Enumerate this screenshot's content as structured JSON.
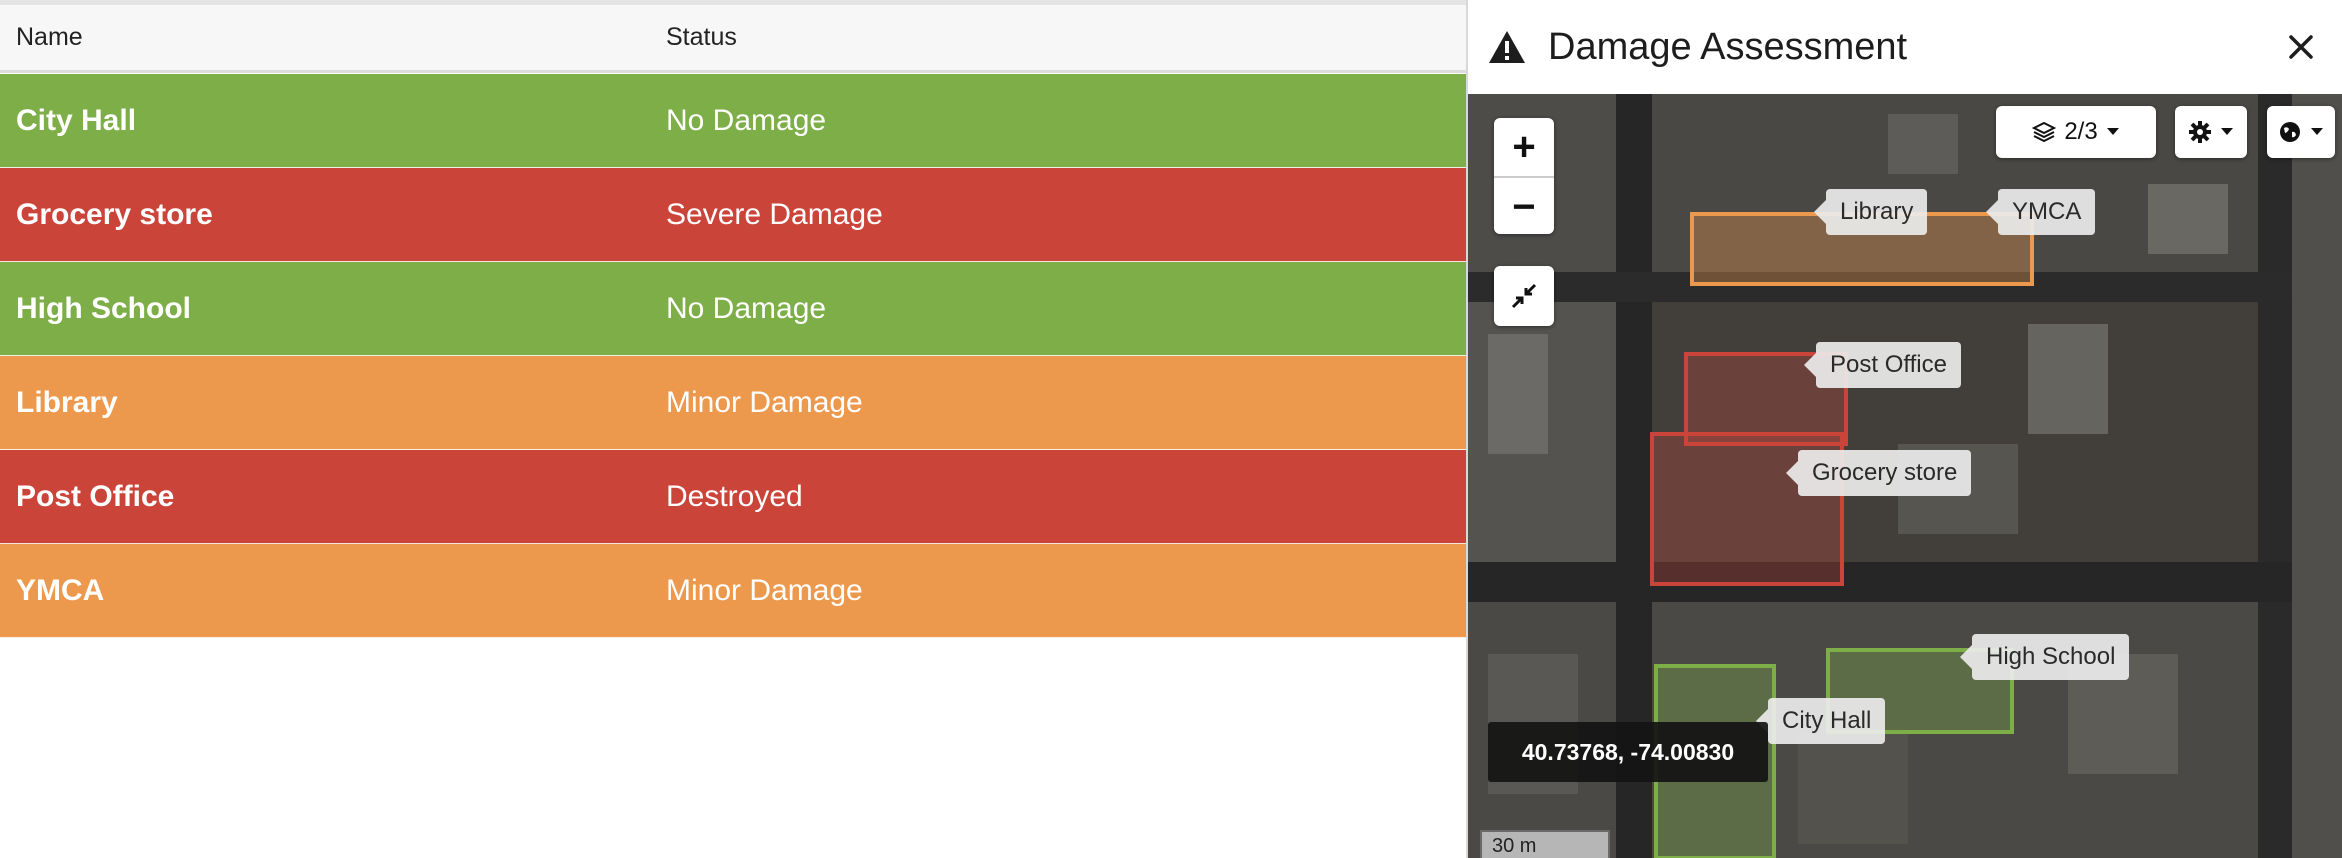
{
  "table": {
    "columns": {
      "name": "Name",
      "status": "Status"
    },
    "rows": [
      {
        "name": "City Hall",
        "status": "No Damage",
        "color": "#7eae48"
      },
      {
        "name": "Grocery store",
        "status": "Severe Damage",
        "color": "#cb443a"
      },
      {
        "name": "High School",
        "status": "No Damage",
        "color": "#7eae48"
      },
      {
        "name": "Library",
        "status": "Minor Damage",
        "color": "#ec994e"
      },
      {
        "name": "Post Office",
        "status": "Destroyed",
        "color": "#cb443a"
      },
      {
        "name": "YMCA",
        "status": "Minor Damage",
        "color": "#ec994e"
      }
    ]
  },
  "panel": {
    "title": "Damage Assessment",
    "icon": "warning-icon",
    "close_icon": "close-icon"
  },
  "map": {
    "zoom_in": "+",
    "zoom_out": "−",
    "layers_label": "2/3",
    "coordinates": "40.73768, -74.00830",
    "scale": "30 m",
    "labels": {
      "library": "Library",
      "ymca": "YMCA",
      "post_office": "Post Office",
      "grocery": "Grocery store",
      "high_school": "High School",
      "city_hall": "City Hall"
    }
  },
  "colors": {
    "no_damage": "#7eae48",
    "severe": "#cb443a",
    "minor": "#ec994e"
  }
}
